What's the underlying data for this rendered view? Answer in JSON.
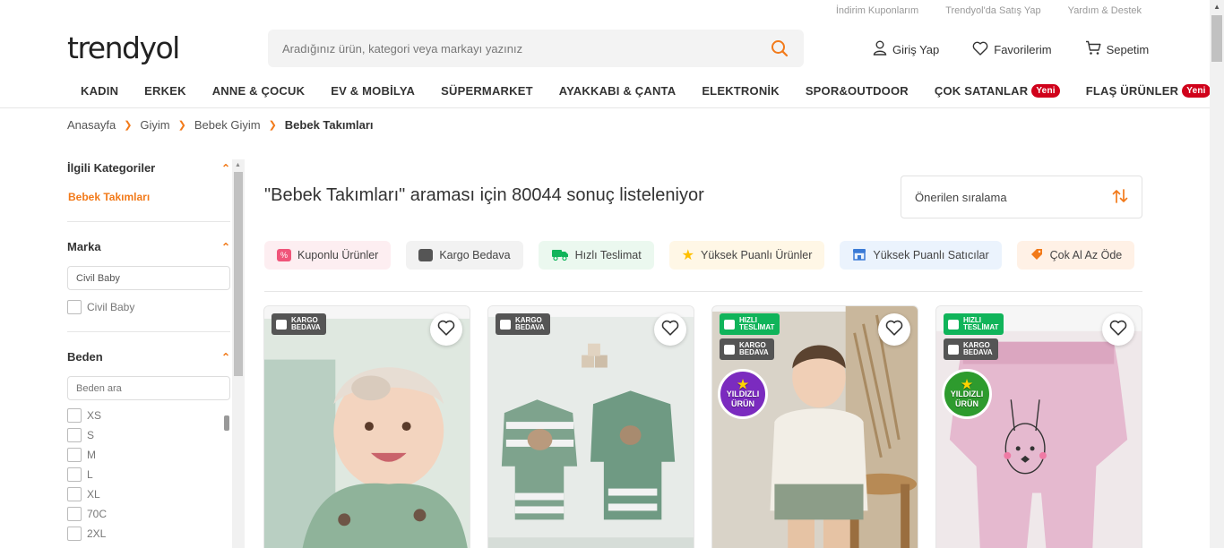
{
  "util_links": [
    "İndirim Kuponlarım",
    "Trendyol'da Satış Yap",
    "Yardım & Destek"
  ],
  "logo": "trendyol",
  "search": {
    "placeholder": "Aradığınız ürün, kategori veya markayı yazınız"
  },
  "header_actions": {
    "login": "Giriş Yap",
    "favorites": "Favorilerim",
    "cart": "Sepetim"
  },
  "nav": [
    {
      "label": "KADIN"
    },
    {
      "label": "ERKEK"
    },
    {
      "label": "ANNE & ÇOCUK"
    },
    {
      "label": "EV & MOBİLYA"
    },
    {
      "label": "SÜPERMARKET"
    },
    {
      "label": "AYAKKABI & ÇANTA"
    },
    {
      "label": "ELEKTRONİK"
    },
    {
      "label": "SPOR&OUTDOOR"
    },
    {
      "label": "ÇOK SATANLAR",
      "badge": "Yeni"
    },
    {
      "label": "FLAŞ ÜRÜNLER",
      "badge": "Yeni"
    }
  ],
  "breadcrumb": [
    "Anasayfa",
    "Giyim",
    "Bebek Giyim",
    "Bebek Takımları"
  ],
  "sidebar": {
    "related_title": "İlgili Kategoriler",
    "related_link": "Bebek Takımları",
    "brand_title": "Marka",
    "brand_input_value": "Civil Baby",
    "brand_options": [
      "Civil Baby"
    ],
    "size_title": "Beden",
    "size_placeholder": "Beden ara",
    "sizes": [
      "XS",
      "S",
      "M",
      "L",
      "XL",
      "70C",
      "2XL"
    ]
  },
  "result_title": "\"Bebek Takımları\" araması için 80044 sonuç listeleniyor",
  "sort_label": "Önerilen sıralama",
  "quick_filters": [
    {
      "label": "Kuponlu Ürünler",
      "bg": "#fdeef1",
      "icon_color": "#f0557a"
    },
    {
      "label": "Kargo Bedava",
      "bg": "#f2f2f2",
      "icon_color": "#555555"
    },
    {
      "label": "Hızlı Teslimat",
      "bg": "#ebf8ef",
      "icon_color": "#10b45a"
    },
    {
      "label": "Yüksek Puanlı Ürünler",
      "bg": "#fff7e6",
      "icon_color": "#ffc000"
    },
    {
      "label": "Yüksek Puanlı Satıcılar",
      "bg": "#ebf3fd",
      "icon_color": "#3b7bd6"
    },
    {
      "label": "Çok Al Az Öde",
      "bg": "#fff1e6",
      "icon_color": "#f27a1a"
    }
  ],
  "products": [
    {
      "tags": [
        {
          "type": "kargo",
          "l1": "KARGO",
          "l2": "BEDAVA"
        }
      ],
      "badge": ""
    },
    {
      "tags": [
        {
          "type": "kargo",
          "l1": "KARGO",
          "l2": "BEDAVA"
        }
      ],
      "badge": ""
    },
    {
      "tags": [
        {
          "type": "hizli",
          "l1": "HIZLI",
          "l2": "TESLİMAT"
        },
        {
          "type": "kargo",
          "l1": "KARGO",
          "l2": "BEDAVA"
        }
      ],
      "badge": "YILDIZLI ÜRÜN",
      "badge_color": "#7b2bbf"
    },
    {
      "tags": [
        {
          "type": "hizli",
          "l1": "HIZLI",
          "l2": "TESLİMAT"
        },
        {
          "type": "kargo",
          "l1": "KARGO",
          "l2": "BEDAVA"
        }
      ],
      "badge": "YILDIZLI ÜRÜN",
      "badge_color": "#2e9b2e"
    }
  ],
  "colors": {
    "accent": "#f27a1a",
    "new_badge": "#d0021b"
  }
}
